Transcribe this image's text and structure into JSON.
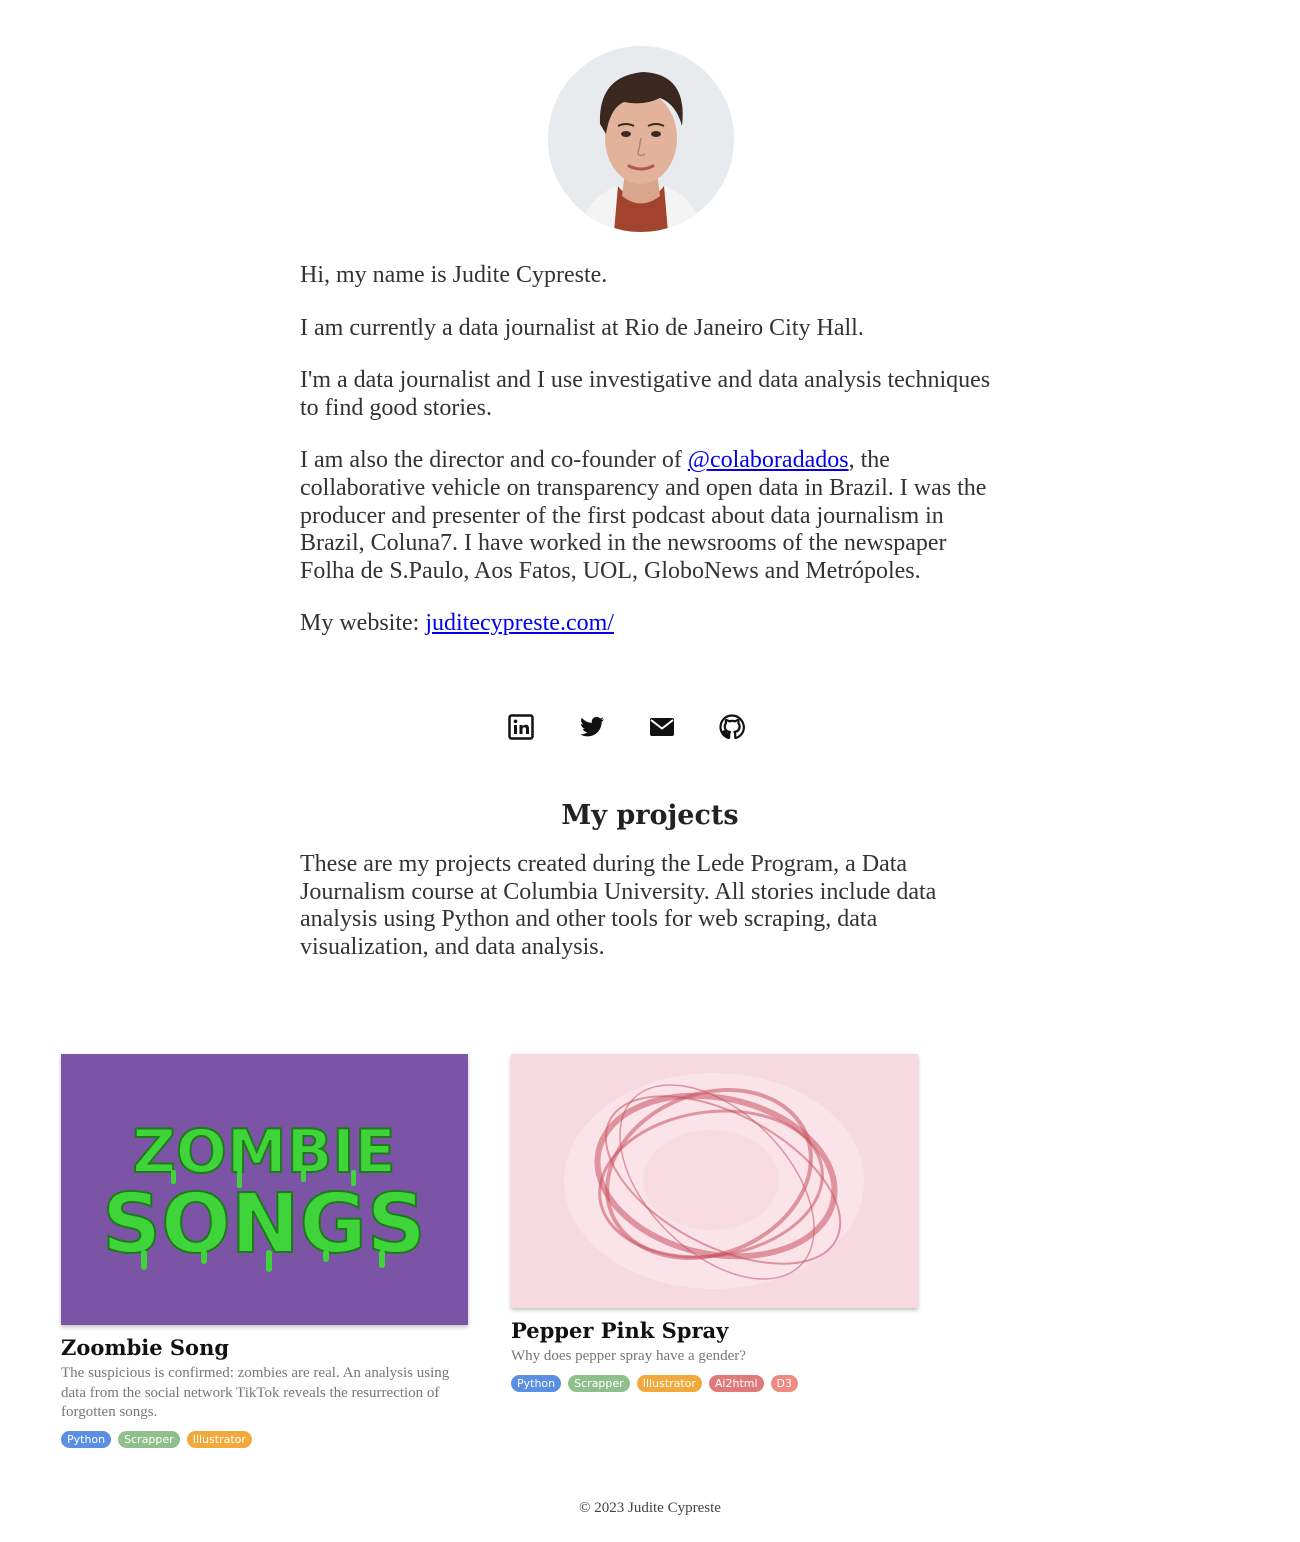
{
  "profile": {
    "avatar_alt": "",
    "greeting": "Hi, my name is Judite Cypreste.",
    "current_role": "I am currently a data journalist at Rio de Janeiro City Hall.",
    "approach": "I'm a data journalist and I use investigative and data analysis techniques to find good stories.",
    "director_prefix": "I am also the director and co-founder of ",
    "director_link": "@colaboradados",
    "director_suffix": ", the collaborative vehicle on transparency and open data in Brazil. I was the producer and presenter of the first podcast about data journalism in Brazil, Coluna7. I have worked in the newsrooms of the newspaper Folha de S.Paulo, Aos Fatos, UOL, GloboNews and Metrópoles.",
    "website_prefix": "My website: ",
    "website_link": "juditecypreste.com/"
  },
  "socials": [
    {
      "icon": "linkedin-icon"
    },
    {
      "icon": "twitter-icon"
    },
    {
      "icon": "email-icon"
    },
    {
      "icon": "github-icon"
    }
  ],
  "projects": {
    "heading": "My projects",
    "intro": "These are my projects created during the Lede Program, a Data Journalism course at Columbia University. All stories include data analysis using Python and other tools for web scraping, data visualization, and data analysis.",
    "items": [
      {
        "title": "Zoombie Song",
        "thumb_line1": "ZOMBIE",
        "thumb_line2": "SONGS",
        "description": "The suspicious is confirmed: zombies are real. An analysis using data from the social network TikTok reveals the resurrection of forgotten songs.",
        "tags": [
          "Python",
          "Scrapper",
          "Illustrator"
        ]
      },
      {
        "title": "Pepper Pink Spray",
        "description": "Why does pepper spray have a gender?",
        "tags": [
          "Python",
          "Scrapper",
          "Illustrator",
          "Ai2html",
          "D3"
        ]
      }
    ]
  },
  "colors": {
    "link": "#0000ee",
    "tag_python": "#5b8fe3",
    "tag_scrapper": "#8fbf8a",
    "tag_illustrator": "#f2a93b",
    "tag_ai2html": "#e07a7a",
    "tag_d3": "#ee8a80",
    "zombie_bg": "#7b54a6",
    "zombie_text": "#3ed43a",
    "pepper_bg": "#f7d9e2"
  },
  "footer": {
    "copyright": "© 2023 Judite Cypreste"
  }
}
